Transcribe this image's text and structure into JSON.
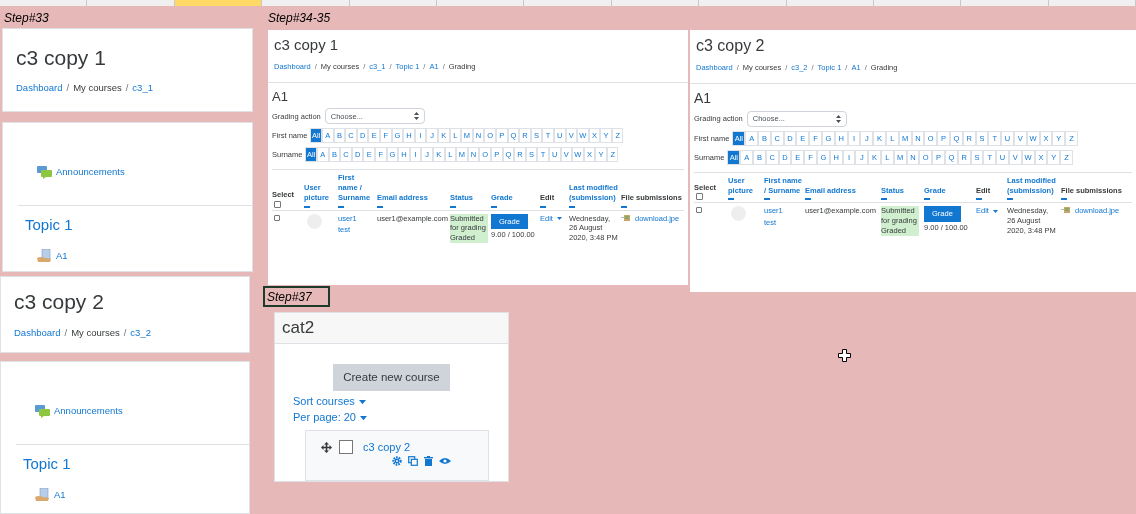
{
  "spreadsheet": {
    "column_headers": [
      {
        "selected": false
      },
      {
        "selected": false
      },
      {
        "selected": true
      },
      {
        "selected": false
      },
      {
        "selected": false
      },
      {
        "selected": false
      },
      {
        "selected": false
      },
      {
        "selected": false
      },
      {
        "selected": false
      },
      {
        "selected": false
      },
      {
        "selected": false
      },
      {
        "selected": false
      },
      {
        "selected": false
      }
    ]
  },
  "step_labels": [
    {
      "text": "Step#33",
      "selected": false
    },
    {
      "text": "Step#34-35",
      "selected": false
    },
    {
      "text": "Step#37",
      "selected": true
    }
  ],
  "course_pages": [
    {
      "title": "c3 copy 1",
      "breadcrumb": [
        {
          "text": "Dashboard",
          "link": true
        },
        {
          "text": "My courses",
          "link": false,
          "separator": "/"
        },
        {
          "text": "c3_1",
          "link": true,
          "separator": "/"
        }
      ],
      "announcements": "Announcements",
      "section": "Topic 1",
      "activity": "A1"
    },
    {
      "title": "c3 copy 2",
      "breadcrumb": [
        {
          "text": "Dashboard",
          "link": true
        },
        {
          "text": "My courses",
          "link": false,
          "separator": "/"
        },
        {
          "text": "c3_2",
          "link": true,
          "separator": "/"
        }
      ],
      "announcements": "Announcements",
      "section": "Topic 1",
      "activity": "A1"
    }
  ],
  "grading_pages": [
    {
      "title": "c3 copy 1",
      "breadcrumb": [
        {
          "text": "Dashboard",
          "link": true
        },
        {
          "text": "My courses",
          "link": false,
          "separator": "/"
        },
        {
          "text": "c3_1",
          "link": true,
          "separator": "/"
        },
        {
          "text": "Topic 1",
          "link": true,
          "separator": "/"
        },
        {
          "text": "A1",
          "link": true,
          "separator": "/"
        },
        {
          "text": "Grading",
          "link": false,
          "separator": "/"
        }
      ],
      "heading": "A1",
      "grading_action": {
        "label": "Grading action",
        "value": "Choose..."
      },
      "initial_filters": [
        {
          "label": "First name",
          "letters": [
            {
              "text": "All",
              "selected": true
            },
            {
              "text": "A",
              "selected": false
            },
            {
              "text": "B",
              "selected": false
            },
            {
              "text": "C",
              "selected": false
            },
            {
              "text": "D",
              "selected": false
            },
            {
              "text": "E",
              "selected": false
            },
            {
              "text": "F",
              "selected": false
            },
            {
              "text": "G",
              "selected": false
            },
            {
              "text": "H",
              "selected": false
            },
            {
              "text": "I",
              "selected": false
            },
            {
              "text": "J",
              "selected": false
            },
            {
              "text": "K",
              "selected": false
            },
            {
              "text": "L",
              "selected": false
            },
            {
              "text": "M",
              "selected": false
            },
            {
              "text": "N",
              "selected": false
            },
            {
              "text": "O",
              "selected": false
            },
            {
              "text": "P",
              "selected": false
            },
            {
              "text": "Q",
              "selected": false
            },
            {
              "text": "R",
              "selected": false
            },
            {
              "text": "S",
              "selected": false
            },
            {
              "text": "T",
              "selected": false
            },
            {
              "text": "U",
              "selected": false
            },
            {
              "text": "V",
              "selected": false
            },
            {
              "text": "W",
              "selected": false
            },
            {
              "text": "X",
              "selected": false
            },
            {
              "text": "Y",
              "selected": false
            },
            {
              "text": "Z",
              "selected": false
            }
          ]
        },
        {
          "label": "Surname",
          "letters": [
            {
              "text": "All",
              "selected": true
            },
            {
              "text": "A",
              "selected": false
            },
            {
              "text": "B",
              "selected": false
            },
            {
              "text": "C",
              "selected": false
            },
            {
              "text": "D",
              "selected": false
            },
            {
              "text": "E",
              "selected": false
            },
            {
              "text": "F",
              "selected": false
            },
            {
              "text": "G",
              "selected": false
            },
            {
              "text": "H",
              "selected": false
            },
            {
              "text": "I",
              "selected": false
            },
            {
              "text": "J",
              "selected": false
            },
            {
              "text": "K",
              "selected": false
            },
            {
              "text": "L",
              "selected": false
            },
            {
              "text": "M",
              "selected": false
            },
            {
              "text": "N",
              "selected": false
            },
            {
              "text": "O",
              "selected": false
            },
            {
              "text": "P",
              "selected": false
            },
            {
              "text": "Q",
              "selected": false
            },
            {
              "text": "R",
              "selected": false
            },
            {
              "text": "S",
              "selected": false
            },
            {
              "text": "T",
              "selected": false
            },
            {
              "text": "U",
              "selected": false
            },
            {
              "text": "V",
              "selected": false
            },
            {
              "text": "W",
              "selected": false
            },
            {
              "text": "X",
              "selected": false
            },
            {
              "text": "Y",
              "selected": false
            },
            {
              "text": "Z",
              "selected": false
            }
          ]
        }
      ],
      "columns": [
        {
          "label": "Select",
          "link": false,
          "kind": "select",
          "checked": false
        },
        {
          "label": "User picture",
          "link": true,
          "kind": "sortable"
        },
        {
          "label": "First name / Surname",
          "link": true,
          "kind": "sortable"
        },
        {
          "label": "Email address",
          "link": true,
          "kind": "sortable"
        },
        {
          "label": "Status",
          "link": true,
          "kind": "sortable"
        },
        {
          "label": "Grade",
          "link": true,
          "kind": "sortable"
        },
        {
          "label": "Edit",
          "link": false,
          "kind": "sortable"
        },
        {
          "label": "Last modified (submission)",
          "link": true,
          "kind": "sortable"
        },
        {
          "label": "File submissions",
          "link": false,
          "kind": "sortable"
        }
      ],
      "rows": [
        {
          "selected": false,
          "first_name": "user1",
          "surname": "test",
          "email": "user1@example.com",
          "status": [
            "Submitted for grading",
            "Graded"
          ],
          "grade_button": "Grade",
          "grade": "9.00 / 100.00",
          "edit": "Edit",
          "last_modified": "Wednesday, 26 August 2020, 3:48 PM",
          "file": "download.jpe"
        }
      ]
    },
    {
      "title": "c3 copy 2",
      "breadcrumb": [
        {
          "text": "Dashboard",
          "link": true
        },
        {
          "text": "My courses",
          "link": false,
          "separator": "/"
        },
        {
          "text": "c3_2",
          "link": true,
          "separator": "/"
        },
        {
          "text": "Topic 1",
          "link": true,
          "separator": "/"
        },
        {
          "text": "A1",
          "link": true,
          "separator": "/"
        },
        {
          "text": "Grading",
          "link": false,
          "separator": "/"
        }
      ],
      "heading": "A1",
      "grading_action": {
        "label": "Grading action",
        "value": "Choose..."
      },
      "initial_filters": [
        {
          "label": "First name",
          "letters": [
            {
              "text": "All",
              "selected": true
            },
            {
              "text": "A",
              "selected": false
            },
            {
              "text": "B",
              "selected": false
            },
            {
              "text": "C",
              "selected": false
            },
            {
              "text": "D",
              "selected": false
            },
            {
              "text": "E",
              "selected": false
            },
            {
              "text": "F",
              "selected": false
            },
            {
              "text": "G",
              "selected": false
            },
            {
              "text": "H",
              "selected": false
            },
            {
              "text": "I",
              "selected": false
            },
            {
              "text": "J",
              "selected": false
            },
            {
              "text": "K",
              "selected": false
            },
            {
              "text": "L",
              "selected": false
            },
            {
              "text": "M",
              "selected": false
            },
            {
              "text": "N",
              "selected": false
            },
            {
              "text": "O",
              "selected": false
            },
            {
              "text": "P",
              "selected": false
            },
            {
              "text": "Q",
              "selected": false
            },
            {
              "text": "R",
              "selected": false
            },
            {
              "text": "S",
              "selected": false
            },
            {
              "text": "T",
              "selected": false
            },
            {
              "text": "U",
              "selected": false
            },
            {
              "text": "V",
              "selected": false
            },
            {
              "text": "W",
              "selected": false
            },
            {
              "text": "X",
              "selected": false
            },
            {
              "text": "Y",
              "selected": false
            },
            {
              "text": "Z",
              "selected": false
            }
          ]
        },
        {
          "label": "Surname",
          "letters": [
            {
              "text": "All",
              "selected": true
            },
            {
              "text": "A",
              "selected": false
            },
            {
              "text": "B",
              "selected": false
            },
            {
              "text": "C",
              "selected": false
            },
            {
              "text": "D",
              "selected": false
            },
            {
              "text": "E",
              "selected": false
            },
            {
              "text": "F",
              "selected": false
            },
            {
              "text": "G",
              "selected": false
            },
            {
              "text": "H",
              "selected": false
            },
            {
              "text": "I",
              "selected": false
            },
            {
              "text": "J",
              "selected": false
            },
            {
              "text": "K",
              "selected": false
            },
            {
              "text": "L",
              "selected": false
            },
            {
              "text": "M",
              "selected": false
            },
            {
              "text": "N",
              "selected": false
            },
            {
              "text": "O",
              "selected": false
            },
            {
              "text": "P",
              "selected": false
            },
            {
              "text": "Q",
              "selected": false
            },
            {
              "text": "R",
              "selected": false
            },
            {
              "text": "S",
              "selected": false
            },
            {
              "text": "T",
              "selected": false
            },
            {
              "text": "U",
              "selected": false
            },
            {
              "text": "V",
              "selected": false
            },
            {
              "text": "W",
              "selected": false
            },
            {
              "text": "X",
              "selected": false
            },
            {
              "text": "Y",
              "selected": false
            },
            {
              "text": "Z",
              "selected": false
            }
          ]
        }
      ],
      "columns": [
        {
          "label": "Select",
          "link": false,
          "kind": "select",
          "checked": false
        },
        {
          "label": "User picture",
          "link": true,
          "kind": "sortable"
        },
        {
          "label": "First name / Surname",
          "link": true,
          "kind": "sortable"
        },
        {
          "label": "Email address",
          "link": true,
          "kind": "sortable"
        },
        {
          "label": "Status",
          "link": true,
          "kind": "sortable"
        },
        {
          "label": "Grade",
          "link": true,
          "kind": "sortable"
        },
        {
          "label": "Edit",
          "link": false,
          "kind": "sortable"
        },
        {
          "label": "Last modified (submission)",
          "link": true,
          "kind": "sortable"
        },
        {
          "label": "File submissions",
          "link": false,
          "kind": "sortable"
        }
      ],
      "rows": [
        {
          "selected": false,
          "first_name": "user1",
          "surname": "test",
          "email": "user1@example.com",
          "status": [
            "Submitted for grading",
            "Graded"
          ],
          "grade_button": "Grade",
          "grade": "9.00 / 100.00",
          "edit": "Edit",
          "last_modified": "Wednesday, 26 August 2020, 3:48 PM",
          "file": "download.jpe"
        }
      ]
    }
  ],
  "category_page": {
    "title": "cat2",
    "create_button": "Create new course",
    "sort": "Sort courses",
    "per_page": "Per page: 20",
    "courses": [
      {
        "name": "c3 copy 2",
        "selected": false
      }
    ]
  }
}
